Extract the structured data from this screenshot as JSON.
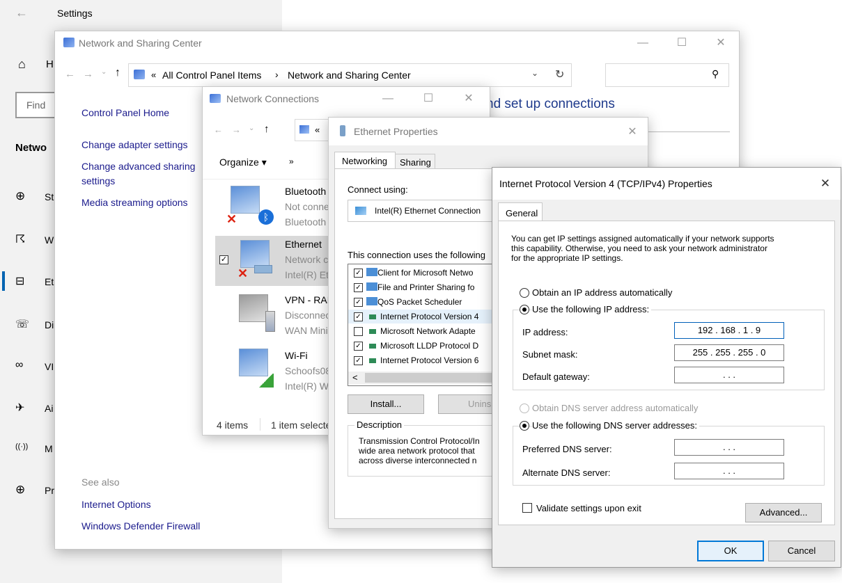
{
  "settings": {
    "title": "Settings",
    "home_label": "H",
    "find_placeholder": "Find",
    "section": "Netwo",
    "nav": [
      {
        "icon": "globe-status-icon",
        "glyph": "⊕",
        "label": "St"
      },
      {
        "icon": "wifi-icon",
        "glyph": "☈",
        "label": "W"
      },
      {
        "icon": "ethernet-icon",
        "glyph": "⊟",
        "label": "Et"
      },
      {
        "icon": "dialup-icon",
        "glyph": "☏",
        "label": "Di"
      },
      {
        "icon": "vpn-icon",
        "glyph": "∞",
        "label": "VI"
      },
      {
        "icon": "airplane-icon",
        "glyph": "✈",
        "label": "Ai"
      },
      {
        "icon": "hotspot-icon",
        "glyph": "((·))",
        "label": "M"
      },
      {
        "icon": "proxy-globe-icon",
        "glyph": "⊕",
        "label": "Pr"
      }
    ]
  },
  "nsc": {
    "title": "Network and Sharing Center",
    "breadcrumb_prefix": "«",
    "breadcrumb_1": "All Control Panel Items",
    "breadcrumb_sep": "›",
    "breadcrumb_2": "Network and Sharing Center",
    "heading_partial": "nd set up connections",
    "links": [
      "Control Panel Home",
      "Change adapter settings",
      "Change advanced sharing",
      "settings",
      "Media streaming options"
    ],
    "see_also": "See also",
    "see_also_links": [
      "Internet Options",
      "Windows Defender Firewall"
    ]
  },
  "netconn": {
    "title": "Network Connections",
    "breadcrumb": "«",
    "organize": "Organize ▾",
    "more": "»",
    "items": [
      {
        "name": "Bluetooth",
        "status": "Not conne",
        "device": "Bluetooth"
      },
      {
        "name": "Ethernet",
        "status": "Network c",
        "device": "Intel(R) Et"
      },
      {
        "name": "VPN - RAI",
        "status": "Disconnec",
        "device": "WAN Mini"
      },
      {
        "name": "Wi-Fi",
        "status": "Schoofs08",
        "device": "Intel(R) W"
      }
    ],
    "status_count": "4 items",
    "status_selected": "1 item selecte"
  },
  "ethprops": {
    "title": "Ethernet Properties",
    "tabs": [
      "Networking",
      "Sharing"
    ],
    "connect_using": "Connect using:",
    "adapter": "Intel(R) Ethernet Connection",
    "uses_items": "This connection uses the following",
    "components": [
      {
        "checked": true,
        "label": "Client for Microsoft Netwo"
      },
      {
        "checked": true,
        "label": "File and Printer Sharing fo"
      },
      {
        "checked": true,
        "label": "QoS Packet Scheduler"
      },
      {
        "checked": true,
        "label": "Internet Protocol Version 4"
      },
      {
        "checked": false,
        "label": "Microsoft Network Adapte"
      },
      {
        "checked": true,
        "label": "Microsoft LLDP Protocol D"
      },
      {
        "checked": true,
        "label": "Internet Protocol Version 6"
      }
    ],
    "scroll_left": "<",
    "install": "Install...",
    "uninstall": "Unins",
    "description_label": "Description",
    "description": [
      "Transmission Control Protocol/In",
      "wide area network protocol that",
      "across diverse interconnected n"
    ]
  },
  "ipv4": {
    "title": "Internet Protocol Version 4 (TCP/IPv4) Properties",
    "tab": "General",
    "intro": [
      "You can get IP settings assigned automatically if your network supports",
      "this capability. Otherwise, you need to ask your network administrator",
      "for the appropriate IP settings."
    ],
    "obtain_ip": "Obtain an IP address automatically",
    "use_ip": "Use the following IP address:",
    "ip_label": "IP address:",
    "ip_value": "192 . 168 .  1  .  9",
    "subnet_label": "Subnet mask:",
    "subnet_value": "255 . 255 . 255 .  0",
    "gateway_label": "Default gateway:",
    "empty_ip": ".      .      .",
    "obtain_dns": "Obtain DNS server address automatically",
    "use_dns": "Use the following DNS server addresses:",
    "pref_dns_label": "Preferred DNS server:",
    "alt_dns_label": "Alternate DNS server:",
    "validate": "Validate settings upon exit",
    "advanced": "Advanced...",
    "ok": "OK",
    "cancel": "Cancel"
  }
}
